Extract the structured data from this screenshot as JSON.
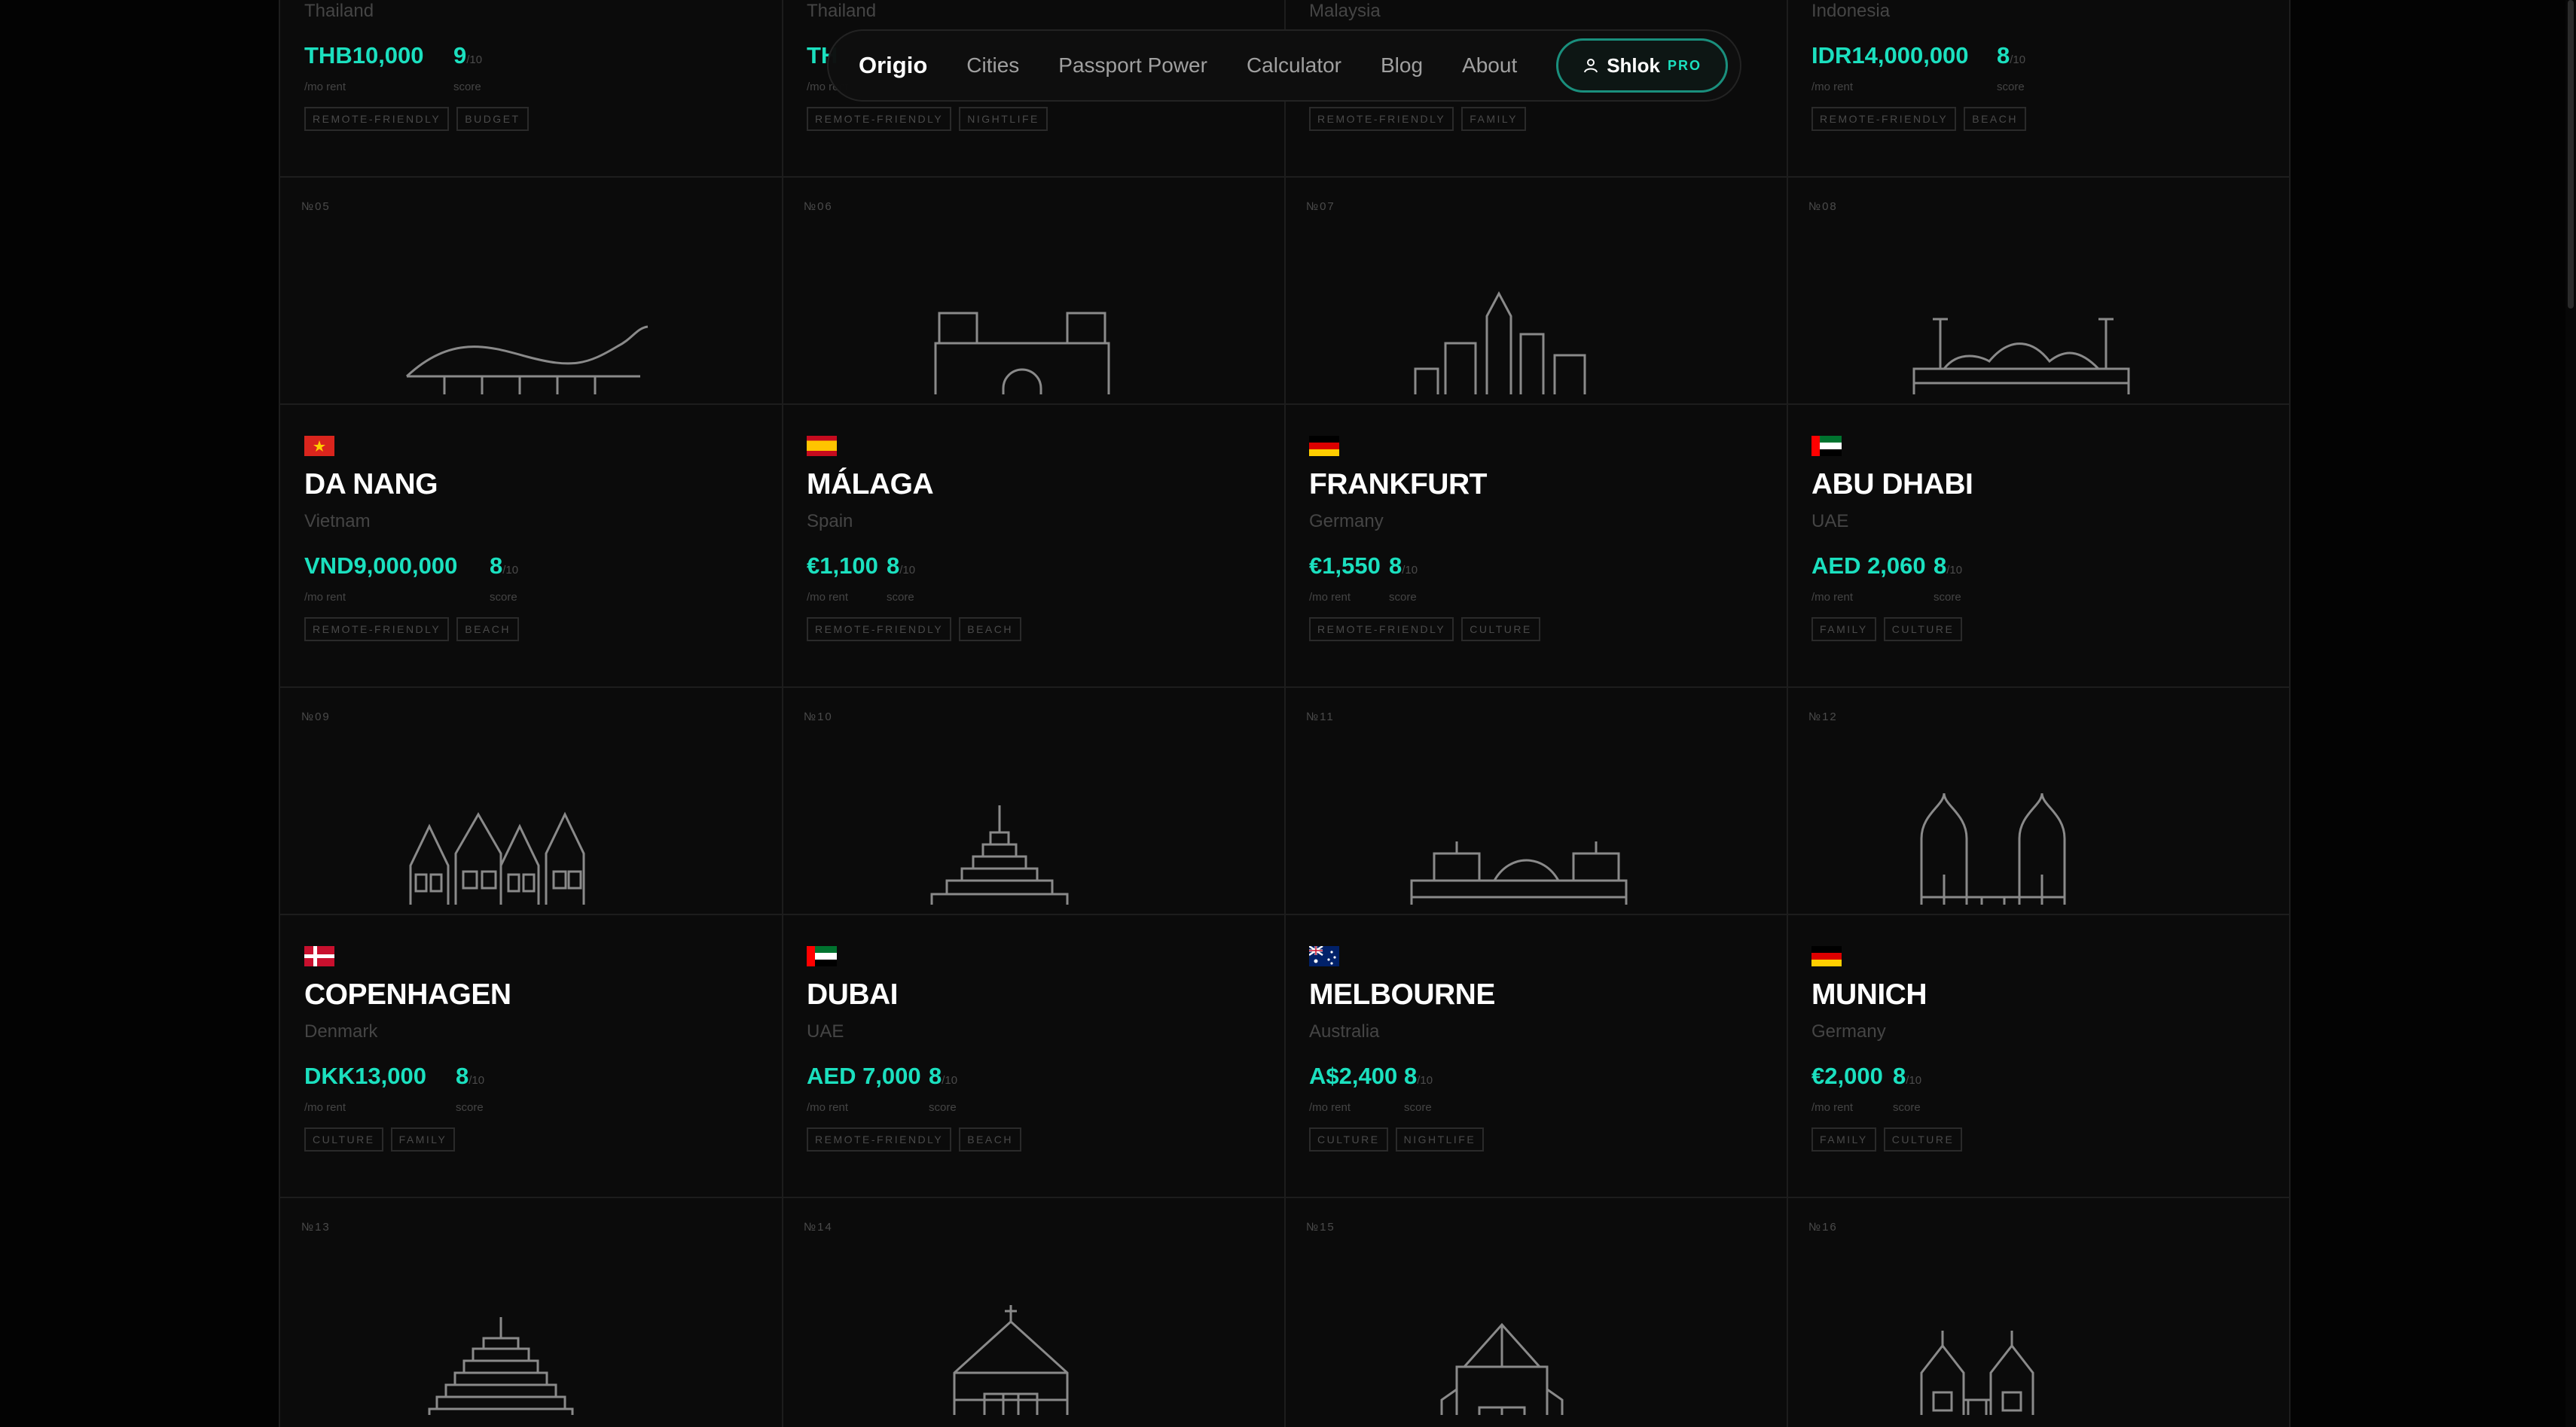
{
  "nav": {
    "brand": "Origio",
    "links": [
      "Cities",
      "Passport Power",
      "Calculator",
      "Blog",
      "About"
    ],
    "user": "Shlok",
    "badge": "PRO"
  },
  "labels": {
    "rent": "/mo rent",
    "score": "score",
    "score_den": "/10"
  },
  "top_cards": [
    {
      "country": "Thailand",
      "rent": "THB10,000",
      "score": "9",
      "tags": [
        "REMOTE-FRIENDLY",
        "BUDGET"
      ]
    },
    {
      "country": "Thailand",
      "rent": "TH",
      "score": "",
      "tags": [
        "REMOTE-FRIENDLY",
        "NIGHTLIFE"
      ]
    },
    {
      "country": "Malaysia",
      "rent": "",
      "score": "",
      "tags": [
        "REMOTE-FRIENDLY",
        "FAMILY"
      ]
    },
    {
      "country": "Indonesia",
      "rent": "IDR14,000,000",
      "score": "8",
      "tags": [
        "REMOTE-FRIENDLY",
        "BEACH"
      ]
    }
  ],
  "landmarks_row1": [
    "№05",
    "№06",
    "№07",
    "№08"
  ],
  "cards_row1": [
    {
      "flag": "vietnam",
      "city": "DA NANG",
      "country": "Vietnam",
      "rent": "VND9,000,000",
      "score": "8",
      "tags": [
        "REMOTE-FRIENDLY",
        "BEACH"
      ]
    },
    {
      "flag": "spain",
      "city": "MÁLAGA",
      "country": "Spain",
      "rent": "€1,100",
      "score": "8",
      "tags": [
        "REMOTE-FRIENDLY",
        "BEACH"
      ]
    },
    {
      "flag": "germany",
      "city": "FRANKFURT",
      "country": "Germany",
      "rent": "€1,550",
      "score": "8",
      "tags": [
        "REMOTE-FRIENDLY",
        "CULTURE"
      ]
    },
    {
      "flag": "uae",
      "city": "ABU DHABI",
      "country": "UAE",
      "rent": "AED 2,060",
      "score": "8",
      "tags": [
        "FAMILY",
        "CULTURE"
      ]
    }
  ],
  "landmarks_row2": [
    "№09",
    "№10",
    "№11",
    "№12"
  ],
  "cards_row2": [
    {
      "flag": "denmark",
      "city": "COPENHAGEN",
      "country": "Denmark",
      "rent": "DKK13,000",
      "score": "8",
      "tags": [
        "CULTURE",
        "FAMILY"
      ]
    },
    {
      "flag": "uae",
      "city": "DUBAI",
      "country": "UAE",
      "rent": "AED 7,000",
      "score": "8",
      "tags": [
        "REMOTE-FRIENDLY",
        "BEACH"
      ]
    },
    {
      "flag": "australia",
      "city": "MELBOURNE",
      "country": "Australia",
      "rent": "A$2,400",
      "score": "8",
      "tags": [
        "CULTURE",
        "NIGHTLIFE"
      ]
    },
    {
      "flag": "germany",
      "city": "MUNICH",
      "country": "Germany",
      "rent": "€2,000",
      "score": "8",
      "tags": [
        "FAMILY",
        "CULTURE"
      ]
    }
  ],
  "landmarks_row3": [
    "№13",
    "№14",
    "№15",
    "№16"
  ],
  "colors": {
    "accent": "#1be0bf",
    "background": "#0b0b0b",
    "muted": "#454545"
  }
}
